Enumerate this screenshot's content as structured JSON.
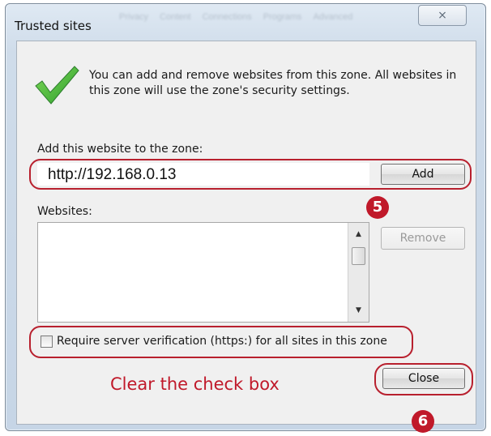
{
  "window": {
    "title": "Trusted sites",
    "close_glyph": "⨯",
    "background_tabs": [
      "Privacy",
      "Content",
      "Connections",
      "Programs",
      "Advanced"
    ]
  },
  "info": {
    "icon": "checkmark-icon",
    "text": "You can add and remove websites from this zone. All websites in this zone will use the zone's security settings."
  },
  "add_site": {
    "label": "Add this website to the zone:",
    "value": "http://192.168.0.13",
    "add_button": "Add"
  },
  "websites": {
    "label": "Websites:",
    "items": [],
    "remove_button": "Remove",
    "scroll_up": "▲",
    "scroll_down": "▼"
  },
  "https_option": {
    "label": "Require server verification (https:) for all sites in this zone",
    "checked": false
  },
  "footer": {
    "close_button": "Close"
  },
  "annotations": {
    "step5": "5",
    "step6": "6",
    "instruction": "Clear the check box",
    "highlight_color": "#b8202e"
  }
}
